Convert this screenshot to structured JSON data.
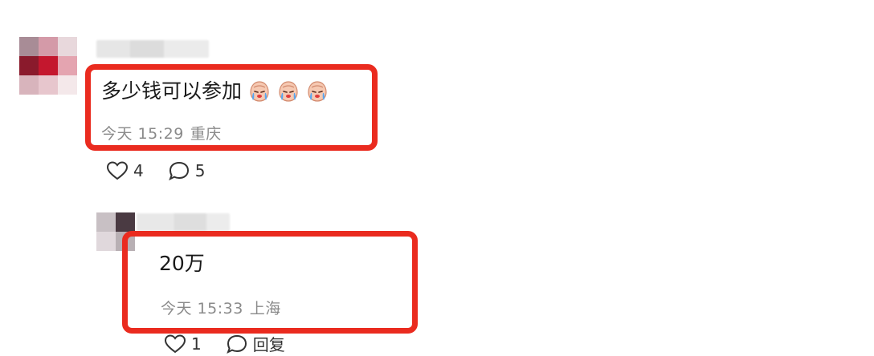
{
  "comment": {
    "text": "多少钱可以参加",
    "emoji": [
      "crying-face-emoji",
      "crying-face-emoji",
      "crying-face-emoji"
    ],
    "time": "今天 15:29",
    "location": "重庆",
    "likes": "4",
    "replies": "5"
  },
  "reply": {
    "text": "20万",
    "time": "今天 15:33",
    "location": "上海",
    "likes": "1",
    "reply_label": "回复"
  },
  "colors": {
    "highlight": "#ea2b1f",
    "meta_text": "#8a8a8a"
  }
}
